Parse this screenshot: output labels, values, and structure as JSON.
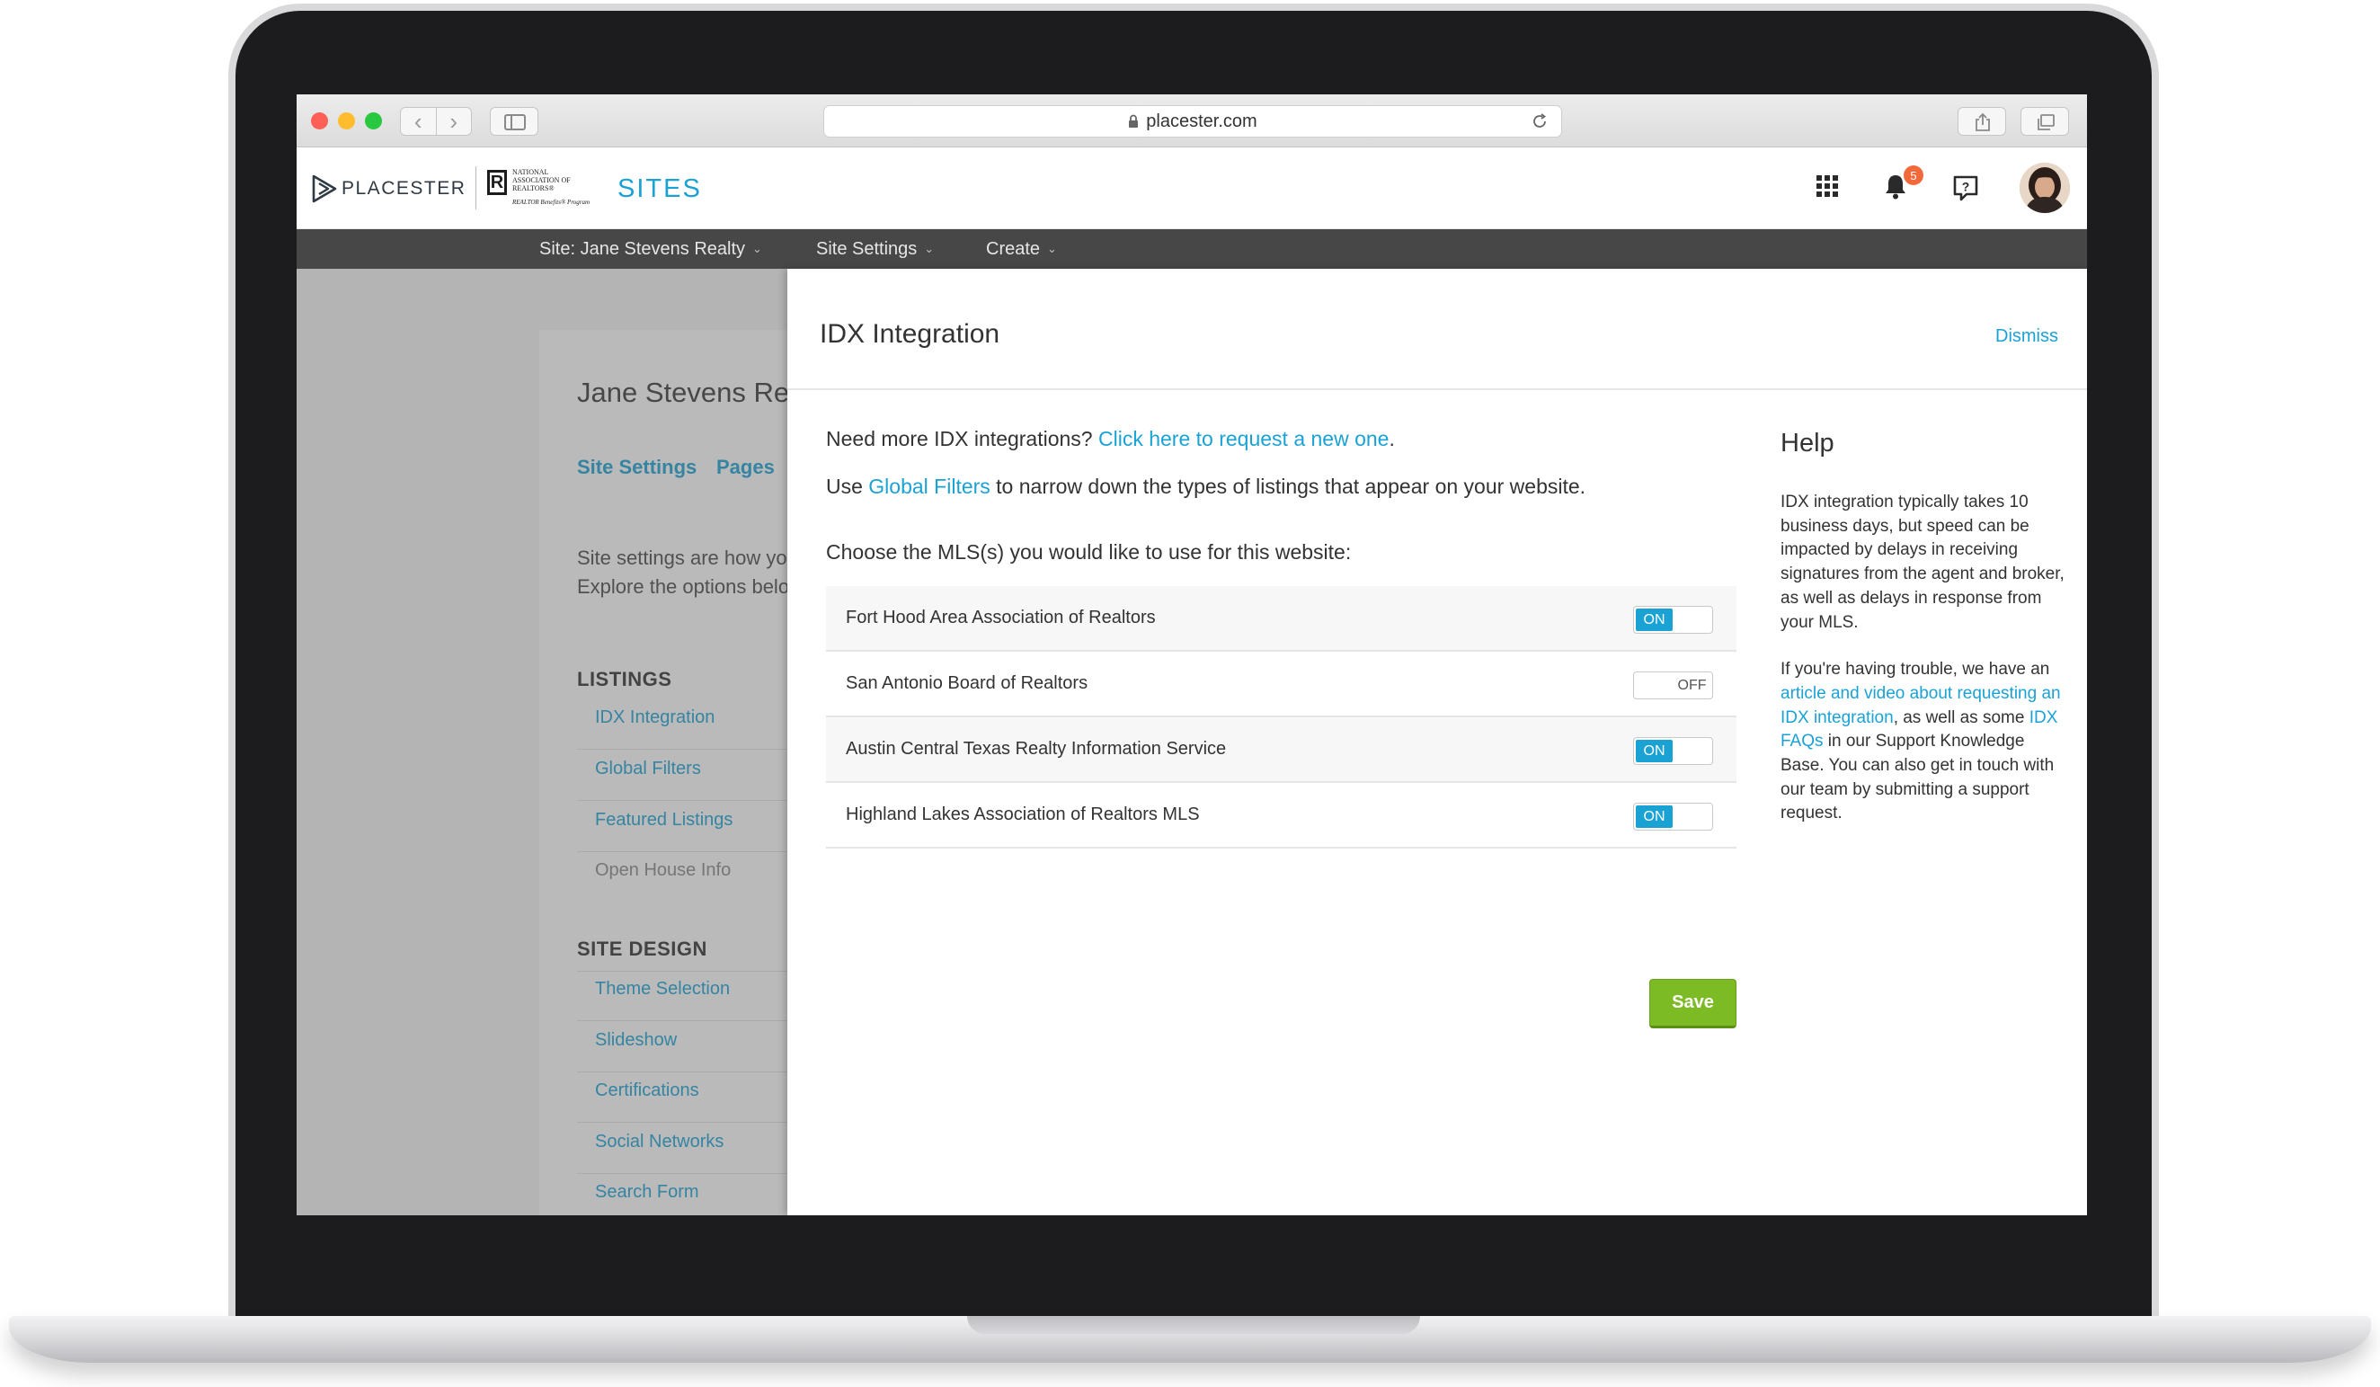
{
  "browser": {
    "url": "placester.com"
  },
  "header": {
    "brand_name": "PLACESTER",
    "partner_lines": [
      "National",
      "Association of",
      "Realtors®"
    ],
    "partner_tagline": "REALTOR Benefits® Program",
    "product": "SITES",
    "notification_count": "5"
  },
  "top_nav": {
    "site_label": "Site: Jane Stevens Realty",
    "settings_label": "Site Settings",
    "create_label": "Create"
  },
  "background_page": {
    "title": "Jane Stevens Realty",
    "tabs": [
      "Site Settings",
      "Pages"
    ],
    "description_lines": [
      "Site settings are how you configure your website.",
      "Explore the options below."
    ],
    "sections": [
      {
        "title": "LISTINGS",
        "items": [
          "IDX Integration",
          "Global Filters",
          "Featured Listings",
          "Open House Info"
        ]
      },
      {
        "title": "SITE DESIGN",
        "items": [
          "Theme Selection",
          "Slideshow",
          "Certifications",
          "Social Networks",
          "Search Form"
        ]
      }
    ]
  },
  "panel": {
    "title": "IDX Integration",
    "dismiss_label": "Dismiss",
    "intro1_text": "Need more IDX integrations?",
    "intro1_link": "Click here to request a new one",
    "intro1_end": ".",
    "intro2_start": "Use",
    "intro2_link": "Global Filters",
    "intro2_end": "to narrow down the types of listings that appear on your website.",
    "choose_label": "Choose the MLS(s) you would like to use for this website:",
    "mls": [
      {
        "name": "Fort Hood Area Association of Realtors",
        "state": "ON"
      },
      {
        "name": "San Antonio Board of Realtors",
        "state": "OFF"
      },
      {
        "name": "Austin Central Texas Realty Information Service",
        "state": "ON"
      },
      {
        "name": "Highland Lakes Association of Realtors MLS",
        "state": "ON"
      }
    ],
    "save_label": "Save"
  },
  "help": {
    "title": "Help",
    "p1": "IDX integration typically takes 10 business days, but speed can be impacted by delays in receiving signatures from the agent and broker, as well as delays in response from your MLS.",
    "p2_start": "If you're having trouble, we have an",
    "p2_link1": "article and video about requesting an IDX integration",
    "p2_mid": ", as well as some",
    "p2_link2": "IDX FAQs",
    "p2_end": "in our Support Knowledge Base. You can also get in touch with our team by submitting a support request."
  },
  "colors": {
    "accent": "#1aa2d5",
    "save": "#7dbb24",
    "nav_bg": "#474747",
    "badge": "#f26a3b"
  },
  "icons": {
    "brand": "placester-play-icon",
    "apps": "grid-icon",
    "notifications": "bell-icon",
    "help": "help-chat-icon",
    "lock": "lock-icon",
    "reload": "reload-icon"
  }
}
